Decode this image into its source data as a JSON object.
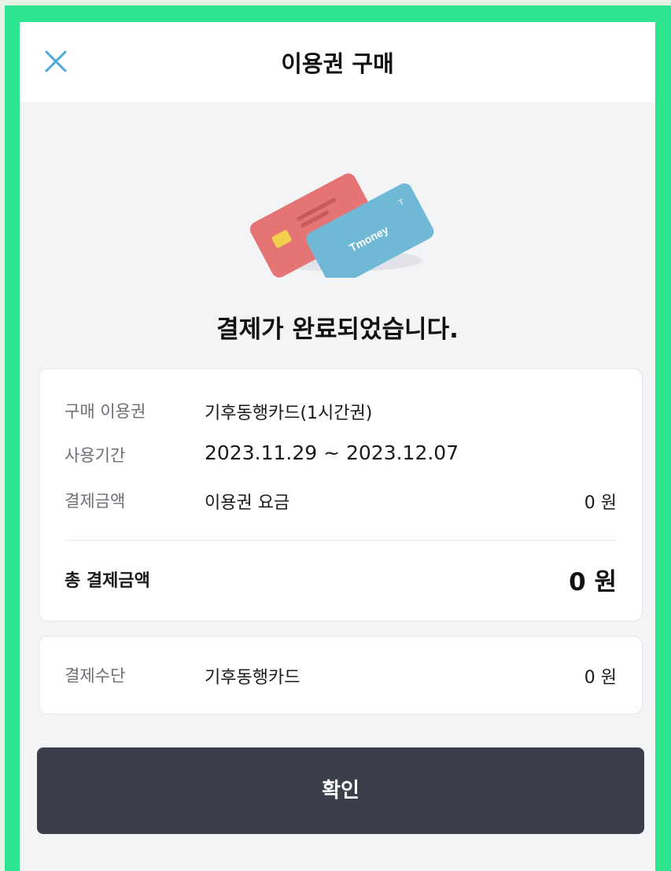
{
  "header": {
    "title": "이용권 구매",
    "close_icon": "close-icon"
  },
  "illustration": {
    "card_text": "Tmoney",
    "icon": "payment-cards-illustration"
  },
  "message": "결제가 완료되었습니다.",
  "summary": {
    "rows": [
      {
        "label": "구매 이용권",
        "value": "기후동행카드(1시간권)"
      },
      {
        "label": "사용기간",
        "value": "2023.11.29 ~ 2023.12.07"
      },
      {
        "label": "결제금액",
        "value": "이용권 요금",
        "amount": "0 원"
      }
    ],
    "total_label": "총 결제금액",
    "total_amount": "0 원"
  },
  "payment_method": {
    "label": "결제수단",
    "value": "기후동행카드",
    "amount": "0 원"
  },
  "confirm_button": {
    "label": "확인"
  },
  "colors": {
    "frame": "#2ee58f",
    "close_icon": "#4aa9d6",
    "button_bg": "#3b3f4a",
    "tmoney_card": "#6fb9d6",
    "red_card": "#e57474"
  }
}
